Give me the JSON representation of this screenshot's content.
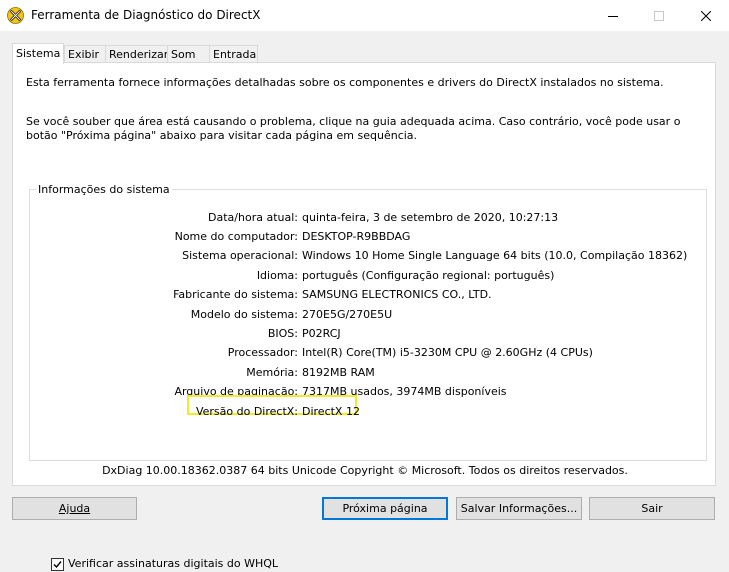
{
  "window": {
    "title": "Ferramenta de Diagnóstico do DirectX",
    "icon": "directx-x-icon",
    "controls": [
      "minimize-icon",
      "maximize-icon",
      "close-icon"
    ]
  },
  "tabs": [
    {
      "label": "Sistema",
      "active": true
    },
    {
      "label": "Exibir",
      "active": false
    },
    {
      "label": "Renderizar",
      "active": false
    },
    {
      "label": "Som",
      "active": false
    },
    {
      "label": "Entrada",
      "active": false
    }
  ],
  "intro": "Esta ferramenta fornece informações detalhadas sobre os componentes e drivers do DirectX instalados no sistema.",
  "help_text": "Se você souber que área está causando o problema, clique na guia adequada acima. Caso contrário, você pode usar o botão \"Próxima página\" abaixo para visitar cada página em sequência.",
  "system_info": {
    "title": "Informações do sistema",
    "rows": [
      {
        "label": "Data/hora atual:",
        "value": "quinta-feira, 3 de setembro de 2020, 10:27:13"
      },
      {
        "label": "Nome do computador:",
        "value": "DESKTOP-R9BBDAG"
      },
      {
        "label": "Sistema operacional:",
        "value": "Windows 10 Home Single Language 64 bits (10.0, Compilação 18362)"
      },
      {
        "label": "Idioma:",
        "value": "português (Configuração regional: português)"
      },
      {
        "label": "Fabricante do sistema:",
        "value": "SAMSUNG ELECTRONICS CO., LTD."
      },
      {
        "label": "Modelo do sistema:",
        "value": "270E5G/270E5U"
      },
      {
        "label": "BIOS:",
        "value": "P02RCJ"
      },
      {
        "label": "Processador:",
        "value": "Intel(R) Core(TM) i5-3230M CPU @ 2.60GHz (4 CPUs)"
      },
      {
        "label": "Memória:",
        "value": "8192MB RAM"
      },
      {
        "label": "Arquivo de paginação:",
        "value": "7317MB usados, 3974MB disponíveis"
      },
      {
        "label": "Versão do DirectX:",
        "value": "DirectX 12"
      }
    ],
    "highlight_color": "#f3ea2a"
  },
  "whql": {
    "label": "Verificar assinaturas digitais do WHQL",
    "checked": true
  },
  "footer": "DxDiag 10.00.18362.0387 64 bits Unicode  Copyright © Microsoft. Todos os direitos reservados.",
  "buttons": {
    "help": "Ajuda",
    "next": "Próxima página",
    "save": "Salvar Informações...",
    "exit": "Sair"
  }
}
